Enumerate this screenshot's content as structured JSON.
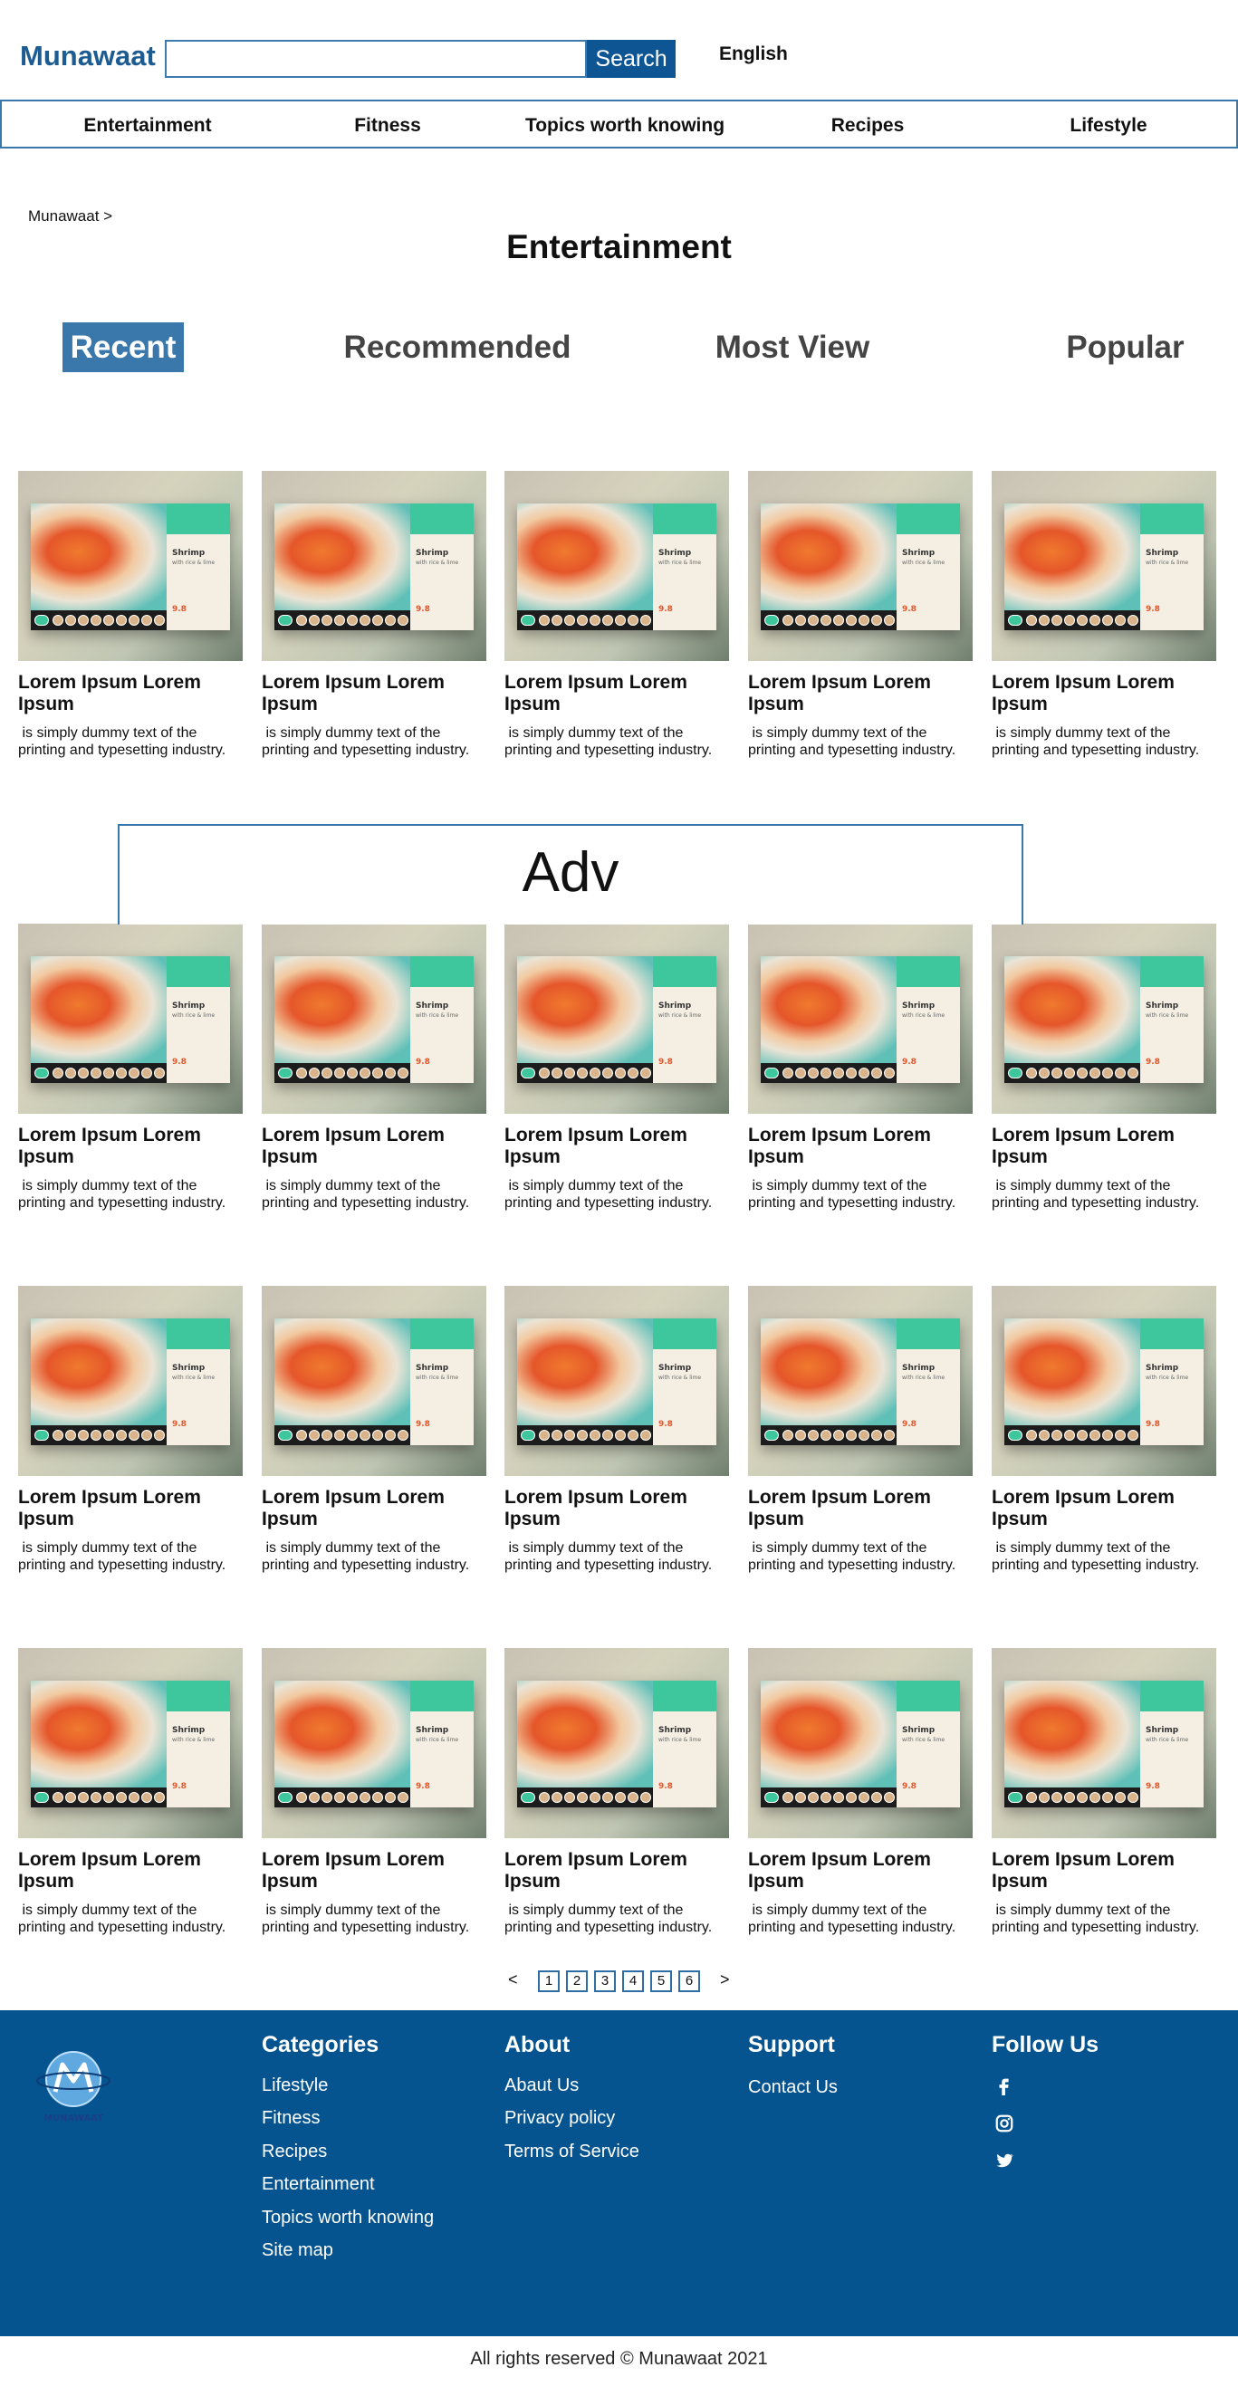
{
  "header": {
    "logo": "Munawaat",
    "search": {
      "value": "",
      "placeholder": "",
      "button_label": "Search"
    },
    "language": "English"
  },
  "nav": [
    "Entertainment",
    "Fitness",
    "Topics worth knowing",
    "Recipes",
    "Lifestyle"
  ],
  "breadcrumb": "Munawaat >",
  "page_title": "Entertainment",
  "tabs": [
    {
      "label": "Recent",
      "active": true
    },
    {
      "label": "Recommended",
      "active": false
    },
    {
      "label": "Most View",
      "active": false
    },
    {
      "label": "Popular",
      "active": false
    }
  ],
  "card": {
    "title": "Lorem Ipsum Lorem Ipsum",
    "description": " is simply dummy text of the printing and typesetting industry.",
    "thumb_title": "Shrimp",
    "thumb_sub": "with rice & lime",
    "thumb_score": "9.8"
  },
  "adv": "Adv",
  "pagination": {
    "prev": "<",
    "next": ">",
    "pages": [
      "1",
      "2",
      "3",
      "4",
      "5",
      "6"
    ]
  },
  "footer": {
    "logo_text": "MUNAWAAT",
    "categories": {
      "title": "Categories",
      "links": [
        "Lifestyle",
        "Fitness",
        "Recipes",
        "Entertainment",
        "Topics worth knowing",
        "Site map"
      ]
    },
    "about": {
      "title": "About",
      "links": [
        "Abaut Us",
        "Privacy policy",
        "Terms of Service"
      ]
    },
    "support": {
      "title": "Support",
      "links": [
        "Contact Us"
      ]
    },
    "follow": {
      "title": "Follow Us",
      "icons": [
        "facebook-icon",
        "instagram-icon",
        "twitter-icon"
      ]
    }
  },
  "copyright": "All rights reserved © Munawaat 2021",
  "colors": {
    "brand": "#05548f",
    "accent": "#3a78ab",
    "thumb_green": "#3ec79c"
  }
}
